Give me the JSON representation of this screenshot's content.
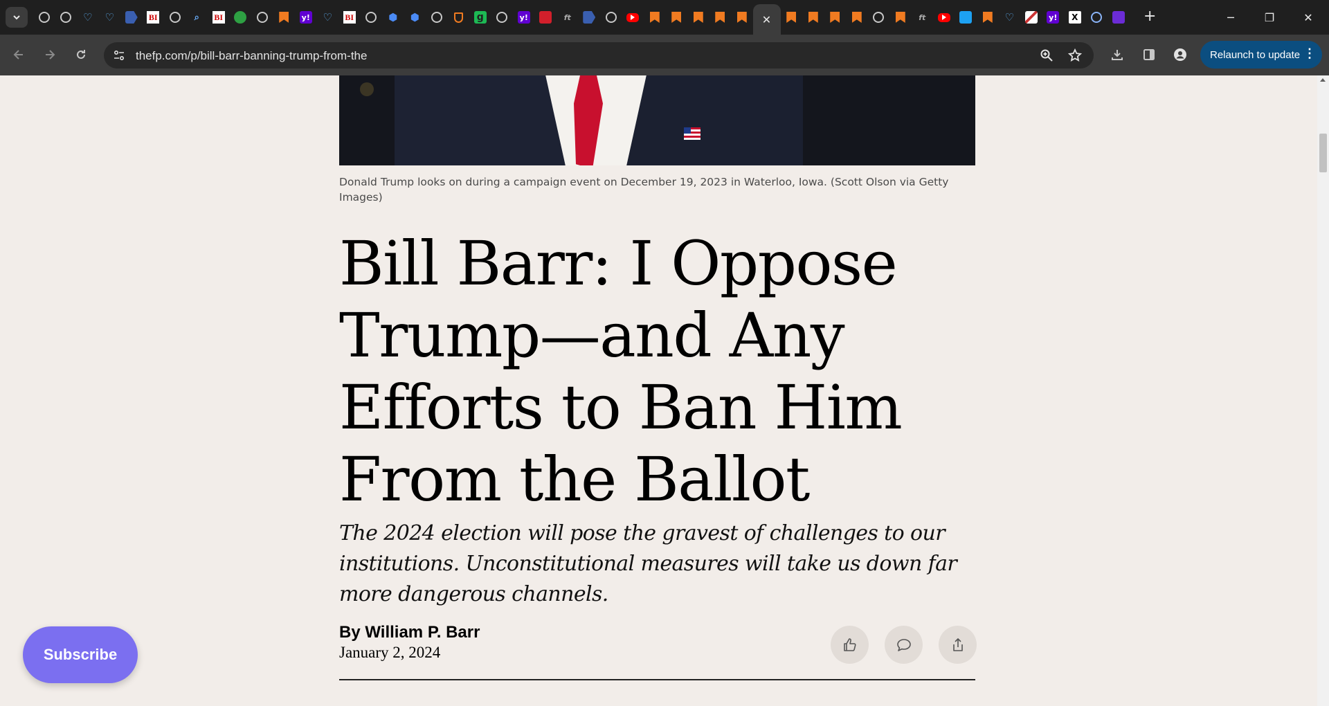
{
  "browser": {
    "tab_favicons": [
      "globe",
      "globe",
      "shield",
      "shield",
      "arrow",
      "bi",
      "globe",
      "search",
      "bi",
      "play",
      "globe",
      "bookmark",
      "yahoo",
      "shield",
      "bi",
      "globe",
      "hex",
      "hex",
      "globe",
      "sh",
      "g",
      "globe",
      "yahoo",
      "red",
      "ft",
      "arrow",
      "globe",
      "yt",
      "bookmark",
      "bookmark",
      "bookmark",
      "bookmark",
      "bookmark"
    ],
    "active_tab_close": "✕",
    "tab_favicons_right": [
      "bookmark",
      "bookmark",
      "bookmark",
      "bookmark",
      "globe",
      "bookmark",
      "ft",
      "yt",
      "blue",
      "bookmark",
      "shield",
      "img",
      "yahoo",
      "x",
      "circle",
      "purple"
    ],
    "bi_label": "BI",
    "x_label": "X",
    "g_label": "g",
    "yahoo_label": "y!",
    "ft_label": "ft",
    "new_tab": "+",
    "minimize": "─",
    "restore": "❐",
    "close": "✕",
    "url": "thefp.com/p/bill-barr-banning-trump-from-the",
    "relaunch_label": "Relaunch to update",
    "relaunch_menu": "⋮"
  },
  "article": {
    "photo_alt": "Donald Trump",
    "caption": "Donald Trump looks on during a campaign event on December 19, 2023 in Waterloo, Iowa. (Scott Olson via Getty Images)",
    "headline": "Bill Barr: I Oppose Trump—and Any Efforts to Ban Him From the Ballot",
    "subtitle": "The 2024 election will pose the gravest of challenges to our institutions. Unconstitutional measures will take us down far more dangerous channels.",
    "byline": "By William P. Barr",
    "date": "January 2, 2024"
  },
  "subscribe_label": "Subscribe",
  "colors": {
    "page_bg": "#f2ede9",
    "subscribe_bg": "#7b6ff0",
    "relaunch_bg": "#0b4e80",
    "tie": "#c8102e"
  }
}
